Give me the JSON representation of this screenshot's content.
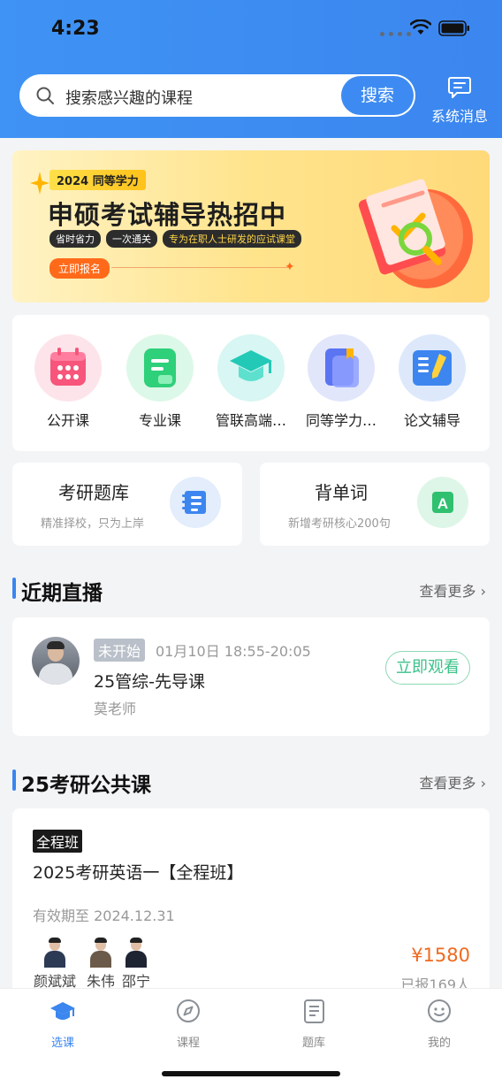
{
  "status_bar": {
    "time": "4:23"
  },
  "header": {
    "search": {
      "placeholder": "搜索感兴趣的课程",
      "button_label": "搜索"
    },
    "messages_label": "系统消息"
  },
  "banner": {
    "tag": "2024 同等学力",
    "title": "申硕考试辅导热招中",
    "pills": [
      "省时省力",
      "一次通关",
      "专为在职人士研发的应试课堂"
    ],
    "button_label": "立即报名"
  },
  "categories": [
    {
      "label": "公开课",
      "icon": "calendar-icon",
      "bg": "#fde4ea",
      "fg": "#f7557b"
    },
    {
      "label": "专业课",
      "icon": "clipboard-icon",
      "bg": "#dcf8e8",
      "fg": "#2fd07a"
    },
    {
      "label": "管联高端…",
      "icon": "graduation-cap-icon",
      "bg": "#d8f6f3",
      "fg": "#22c9b7"
    },
    {
      "label": "同等学力…",
      "icon": "bookmark-book-icon",
      "bg": "#e2e6fb",
      "fg": "#5b74f2"
    },
    {
      "label": "论文辅导",
      "icon": "pen-book-icon",
      "bg": "#dde9fb",
      "fg": "#3d86f0"
    }
  ],
  "quick_cards": [
    {
      "title": "考研题库",
      "subtitle": "精准择校，只为上岸",
      "icon": "question-bank-icon",
      "bg": "#e3edfb",
      "fg": "#3d86f0"
    },
    {
      "title": "背单词",
      "subtitle": "新增考研核心200句",
      "icon": "letter-a-icon",
      "bg": "#def6e8",
      "fg": "#2fc070"
    }
  ],
  "live_section": {
    "title": "近期直播",
    "more_label": "查看更多",
    "item": {
      "status": "未开始",
      "datetime": "01月10日 18:55-20:05",
      "title": "25管综-先导课",
      "teacher": "莫老师",
      "action_label": "立即观看"
    }
  },
  "course_section": {
    "title": "25考研公共课",
    "more_label": "查看更多",
    "item": {
      "tag": "全程班",
      "title": "2025考研英语一【全程班】",
      "valid_until": "有效期至 2024.12.31",
      "teachers": [
        "颜斌斌",
        "朱伟",
        "邵宁"
      ],
      "price": "¥1580",
      "enrolled": "已报169人"
    }
  },
  "tabbar": [
    {
      "label": "选课",
      "icon": "graduation-cap-icon",
      "active": true
    },
    {
      "label": "课程",
      "icon": "compass-icon",
      "active": false
    },
    {
      "label": "题库",
      "icon": "notebook-icon",
      "active": false
    },
    {
      "label": "我的",
      "icon": "smiley-icon",
      "active": false
    }
  ],
  "colors": {
    "primary": "#3b86ef",
    "price": "#f06a1e",
    "watch_green": "#3cc28a"
  }
}
